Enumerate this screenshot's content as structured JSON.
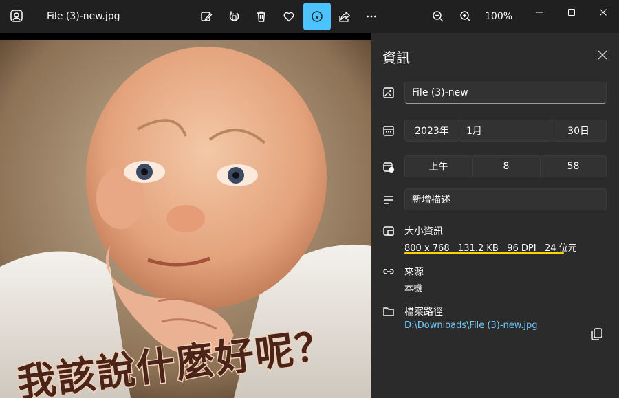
{
  "window": {
    "file_title": "File (3)-new.jpg",
    "zoom": "100%"
  },
  "toolbar": {
    "icons": [
      "edit-image-icon",
      "rotate-icon",
      "delete-icon",
      "favorite-icon",
      "info-icon",
      "share-icon",
      "more-icon",
      "zoom-out-icon",
      "zoom-in-icon"
    ],
    "active": "info-icon",
    "accent_color": "#4cc2ff"
  },
  "image": {
    "caption": "我該說什麼好呢？"
  },
  "info_panel": {
    "title": "資訊",
    "file_name": "File (3)-new",
    "date": {
      "year": "2023年",
      "month": "1月",
      "day": "30日"
    },
    "time": {
      "period": "上午",
      "hour": "8",
      "minute": "58"
    },
    "description_placeholder": "新增描述",
    "size_label": "大小資訊",
    "size": {
      "dimensions": "800 x 768",
      "file_size": "131.2 KB",
      "dpi": "96 DPI",
      "bit_depth": "24 位元"
    },
    "source_label": "來源",
    "source_value": "本機",
    "path_label": "檔案路徑",
    "path_value": "D:\\Downloads\\File (3)-new.jpg",
    "highlight_color": "#f5d400",
    "link_color": "#6cc8ff"
  }
}
